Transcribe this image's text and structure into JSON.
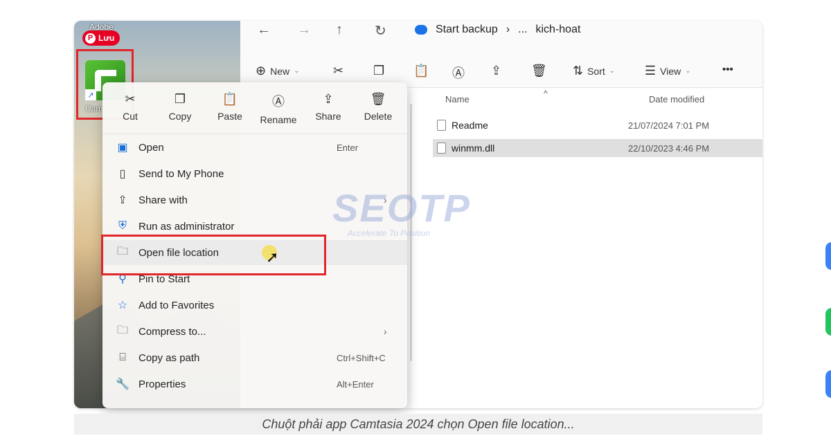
{
  "desktop": {
    "top_label": "Adobe",
    "pinterest_label": "Lưu",
    "camtasia_label": "Cam"
  },
  "explorer": {
    "crumbs": [
      "Start backup",
      "...",
      "kich-hoat"
    ],
    "toolbar": {
      "new_label": "New",
      "sort_label": "Sort",
      "view_label": "View",
      "more_label": "•••"
    },
    "columns": {
      "name": "Name",
      "date": "Date modified"
    },
    "files": [
      {
        "name": "Readme",
        "date": "21/07/2024 7:01 PM"
      },
      {
        "name": "winmm.dll",
        "date": "22/10/2023 4:46 PM"
      }
    ]
  },
  "context_menu": {
    "actions": [
      {
        "label": "Cut",
        "icon": "scissors-icon"
      },
      {
        "label": "Copy",
        "icon": "copy-icon"
      },
      {
        "label": "Paste",
        "icon": "paste-icon"
      },
      {
        "label": "Rename",
        "icon": "rename-icon"
      },
      {
        "label": "Share",
        "icon": "share-icon"
      },
      {
        "label": "Delete",
        "icon": "trash-icon"
      }
    ],
    "items": [
      {
        "label": "Open",
        "shortcut": "Enter"
      },
      {
        "label": "Send to My Phone",
        "shortcut": ""
      },
      {
        "label": "Share with",
        "shortcut": ""
      },
      {
        "label": "Run as administrator",
        "shortcut": ""
      },
      {
        "label": "Open file location",
        "shortcut": ""
      },
      {
        "label": "Pin to Start",
        "shortcut": ""
      },
      {
        "label": "Add to Favorites",
        "shortcut": ""
      },
      {
        "label": "Compress to...",
        "shortcut": ""
      },
      {
        "label": "Copy as path",
        "shortcut": "Ctrl+Shift+C"
      },
      {
        "label": "Properties",
        "shortcut": "Alt+Enter"
      }
    ]
  },
  "watermark": {
    "brand": "SEOTP",
    "tagline": "Accelerate To Position"
  },
  "caption": "Chuột phải app Camtasia 2024 chọn Open file location...",
  "colors": {
    "highlight_box": "#e0252b",
    "pinterest": "#e60023",
    "accent": "#1a73e8"
  }
}
